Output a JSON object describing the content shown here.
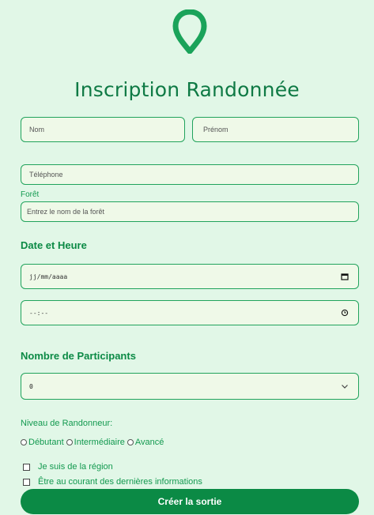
{
  "form": {
    "title": "Inscription Randonnée",
    "nom_placeholder": "Nom",
    "prenom_placeholder": "Prénom",
    "telephone_placeholder": "Téléphone",
    "foret_label": "Forêt",
    "foret_placeholder": "Entrez le nom de la forêt",
    "date_section": "Date et Heure",
    "date_value": "jj/mm/aaaa",
    "time_value": "--:--",
    "participants_section": "Nombre de Participants",
    "participants_value": "0",
    "level_label": "Niveau de Randonneur:",
    "levels": [
      "Débutant",
      "Intermédiaire",
      "Avancé"
    ],
    "checkbox_region": "Je suis de la région",
    "checkbox_news": "Être au courant des dernières informations",
    "submit_label": "Créer la sortie"
  },
  "colors": {
    "background": "#e1f7e7",
    "accent": "#0b8a45",
    "field_bg": "#eff9e8",
    "border": "#21a35c"
  },
  "icons": [
    "map-pin-icon",
    "calendar-icon",
    "clock-icon",
    "chevron-down-icon"
  ]
}
